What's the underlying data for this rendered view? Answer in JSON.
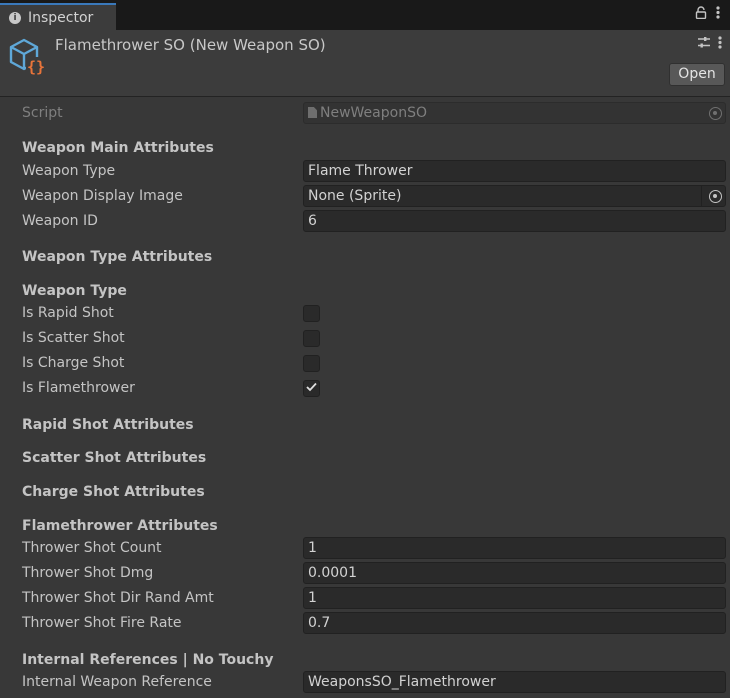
{
  "tab": {
    "label": "Inspector",
    "icon": "info-icon"
  },
  "header": {
    "title": "Flamethrower SO (New Weapon SO)",
    "open_label": "Open"
  },
  "script_row": {
    "label": "Script",
    "value": "NewWeaponSO"
  },
  "weapon_main": {
    "header": "Weapon Main Attributes",
    "weapon_type": {
      "label": "Weapon Type",
      "value": "Flame Thrower"
    },
    "display_image": {
      "label": "Weapon Display Image",
      "value": "None (Sprite)"
    },
    "weapon_id": {
      "label": "Weapon ID",
      "value": "6"
    }
  },
  "weapon_type_attrs": {
    "header": "Weapon Type Attributes",
    "subheader": "Weapon Type",
    "flags": [
      {
        "label": "Is Rapid Shot",
        "checked": false
      },
      {
        "label": "Is Scatter Shot",
        "checked": false
      },
      {
        "label": "Is Charge Shot",
        "checked": false
      },
      {
        "label": "Is Flamethrower",
        "checked": true
      }
    ]
  },
  "rapid_header": "Rapid Shot Attributes",
  "scatter_header": "Scatter Shot Attributes",
  "charge_header": "Charge Shot Attributes",
  "flamethrower": {
    "header": "Flamethrower Attributes",
    "fields": [
      {
        "label": "Thrower Shot Count",
        "value": "1"
      },
      {
        "label": "Thrower Shot Dmg",
        "value": "0.0001"
      },
      {
        "label": "Thrower Shot Dir Rand Amt",
        "value": "1"
      },
      {
        "label": "Thrower Shot Fire Rate",
        "value": "0.7"
      }
    ]
  },
  "internal": {
    "header": "Internal References | No Touchy",
    "weapon_ref": {
      "label": "Internal Weapon Reference",
      "value": "WeaponsSO_Flamethrower"
    }
  },
  "colors": {
    "accent": "#3a79bb",
    "icon_blue": "#5fa8d8",
    "icon_orange": "#e8743a",
    "panel": "#383838"
  }
}
